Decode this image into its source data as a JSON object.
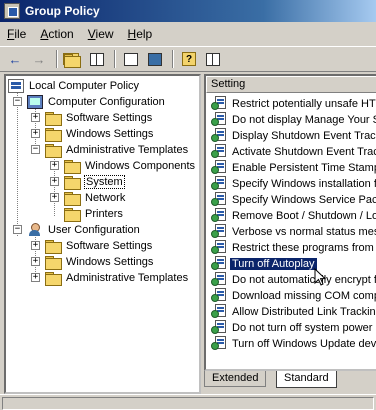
{
  "window": {
    "title": "Group Policy"
  },
  "menu": [
    {
      "label": "File",
      "accel": "F",
      "rest": "ile"
    },
    {
      "label": "Action",
      "accel": "A",
      "rest": "ction"
    },
    {
      "label": "View",
      "accel": "V",
      "rest": "iew"
    },
    {
      "label": "Help",
      "accel": "H",
      "rest": "elp"
    }
  ],
  "toolbar": {
    "buttons": [
      "back-icon",
      "forward-icon",
      "up-folder-icon",
      "show-hide-tree-icon",
      "properties-icon",
      "export-list-icon",
      "help-icon",
      "detail-view-icon"
    ]
  },
  "tree": {
    "root": "Local Computer Policy",
    "computer_config": "Computer Configuration",
    "cc_software": "Software Settings",
    "cc_windows": "Windows Settings",
    "cc_admin": "Administrative Templates",
    "windows_components": "Windows Components",
    "system": "System",
    "network": "Network",
    "printers": "Printers",
    "user_config": "User Configuration",
    "uc_software": "Software Settings",
    "uc_windows": "Windows Settings",
    "uc_admin": "Administrative Templates"
  },
  "list": {
    "column_header": "Setting",
    "settings": [
      "Restrict potentially unsafe HTM",
      "Do not display Manage Your Se",
      "Display Shutdown Event Track",
      "Activate Shutdown Event Track",
      "Enable Persistent Time Stamp",
      "Specify Windows installation file",
      "Specify Windows Service Pack",
      "Remove Boot / Shutdown / Lo",
      "Verbose vs normal status messa",
      "Restrict these programs from be",
      "Turn off Autoplay",
      "Do not automatically encrypt file",
      "Download missing COM compo",
      "Allow Distributed Link Tracking",
      "Do not turn off system power af",
      "Turn off Windows Update devic"
    ],
    "selected_index": 10
  },
  "tabs": {
    "extended": "Extended",
    "standard": "Standard",
    "active": "Standard"
  }
}
